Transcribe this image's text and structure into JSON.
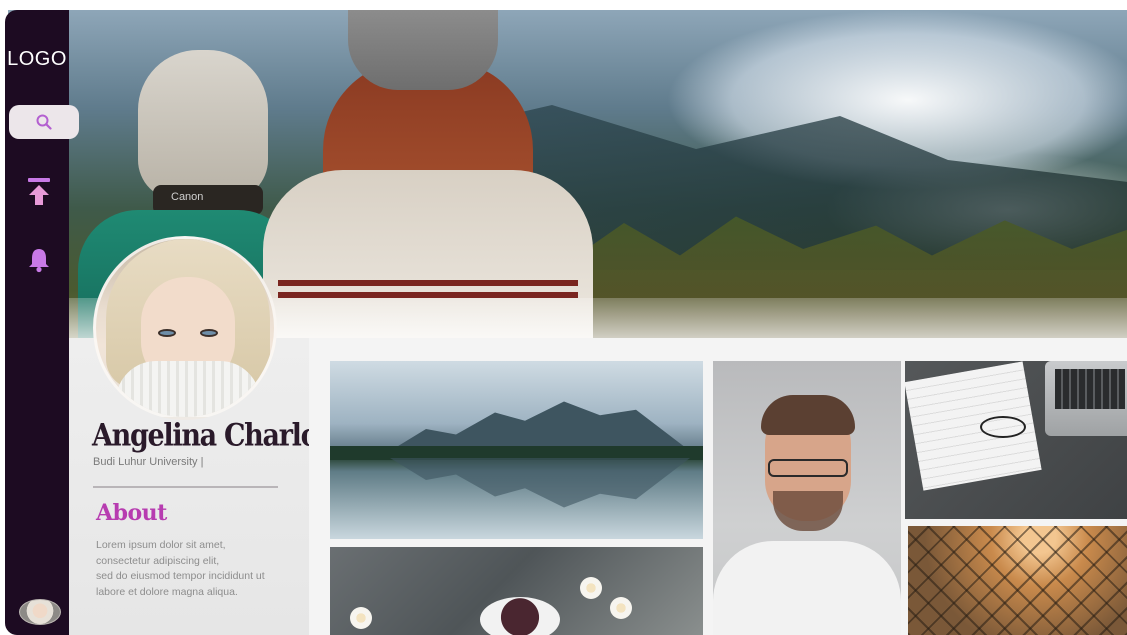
{
  "sidebar": {
    "logo": "LOGO",
    "items": [
      {
        "name": "search",
        "icon": "search-icon",
        "active": true
      },
      {
        "name": "upload",
        "icon": "upload-arrow-icon",
        "active": false
      },
      {
        "name": "notifications",
        "icon": "bell-icon",
        "active": false
      }
    ],
    "avatar_icon": "user-avatar"
  },
  "profile": {
    "name": "Angelina Charlotte",
    "subtitle": "Budi Luhur University |",
    "about_heading": "About",
    "about_lines": [
      "Lorem ipsum dolor sit amet,",
      " consectetur adipiscing elit,",
      "sed do eiusmod tempor incididunt ut",
      "labore et dolore magna aliqua."
    ]
  },
  "hero": {
    "hat_brand": "Canon"
  },
  "gallery": {
    "tiles": [
      "lake-mountains",
      "coffee-flowers",
      "smiling-man-glasses",
      "desk-laptop-glasses",
      "chain-fence"
    ]
  },
  "colors": {
    "sidebar_bg": "#1d0b22",
    "accent_purple": "#b73cb0",
    "icon_purple": "#c879e6",
    "card_bg": "#eeeeee"
  }
}
